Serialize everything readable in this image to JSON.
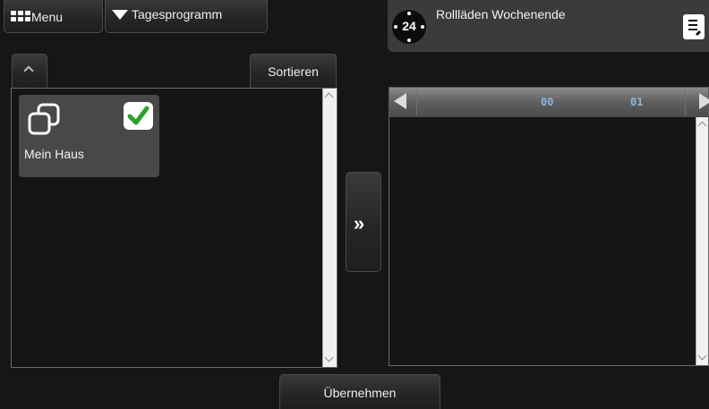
{
  "topbar": {
    "menu_label": "Menu",
    "program_label": "Tagesprogramm"
  },
  "schedule": {
    "clock_label": "24",
    "title": "Rollläden Wochenende"
  },
  "left_panel": {
    "sort_label": "Sortieren",
    "groups": [
      {
        "label": "Mein Haus",
        "checked": true
      }
    ]
  },
  "timeline": {
    "hours": [
      "00",
      "01"
    ]
  },
  "footer": {
    "apply_label": "Übernehmen"
  },
  "colors": {
    "check": "#2e9e2e",
    "hour_text": "#8ab6dc",
    "background": "#161616"
  },
  "icons": {
    "menu": "grid-icon",
    "program": "dropdown-triangle-icon",
    "clock": "clock-24h-icon",
    "note": "notepad-icon",
    "house": "group-squares-icon",
    "move": "double-chevron-right-icon"
  }
}
